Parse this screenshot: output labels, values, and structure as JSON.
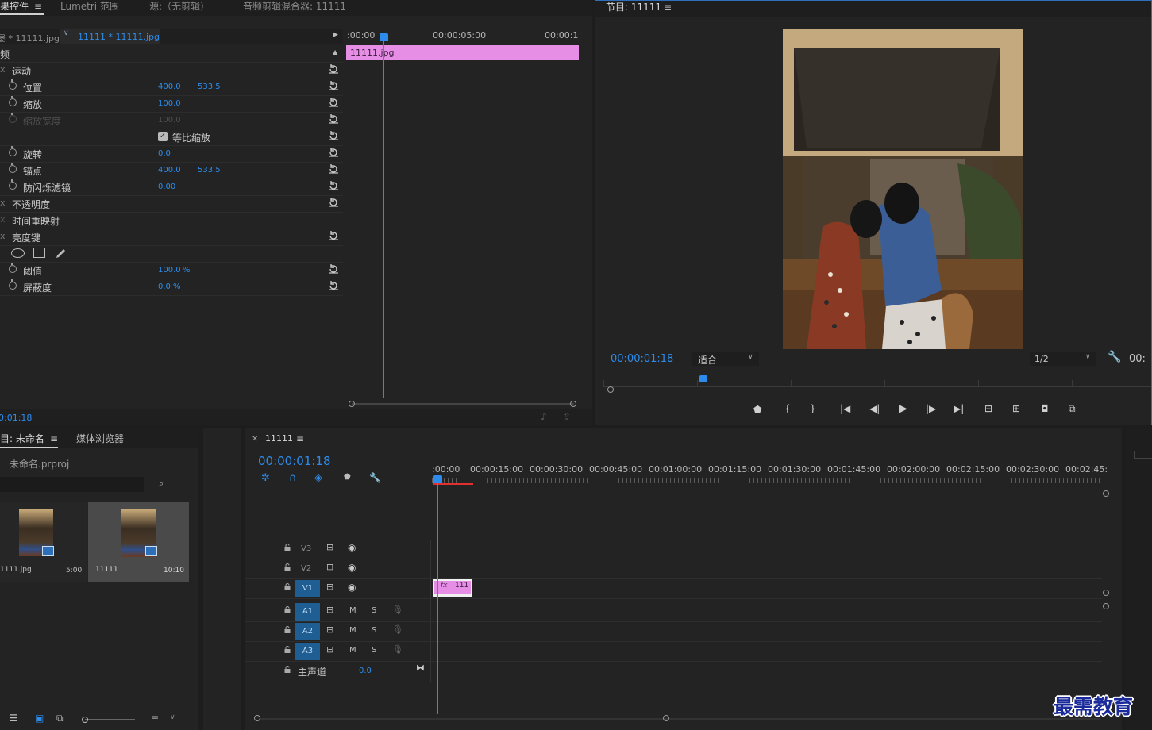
{
  "effect_controls": {
    "tabs": [
      "果控件",
      "Lumetri 范围",
      "源:（无剪辑）",
      "音频剪辑混合器: 11111"
    ],
    "source_label": "屡 * 11111.jpg",
    "clip_dropdown": "11111 * 11111.jpg",
    "section_video": "频",
    "rows": {
      "motion": "运动",
      "position": {
        "label": "位置",
        "x": "400.0",
        "y": "533.5"
      },
      "scale": {
        "label": "缩放",
        "value": "100.0"
      },
      "scale_width": {
        "label": "缩放宽度",
        "value": "100.0"
      },
      "uniform_scale": "等比缩放",
      "rotation": {
        "label": "旋转",
        "value": "0.0"
      },
      "anchor": {
        "label": "锚点",
        "x": "400.0",
        "y": "533.5"
      },
      "anti_flicker": {
        "label": "防闪烁滤镜",
        "value": "0.00"
      },
      "opacity": "不透明度",
      "time_remap": "时间重映射",
      "luma_key": "亮度键",
      "threshold": {
        "label": "阈值",
        "value": "100.0",
        "unit": "%"
      },
      "cutoff": {
        "label": "屏蔽度",
        "value": "0.0",
        "unit": "%"
      }
    },
    "fx_marker": "x",
    "ruler": {
      "t0": ":00:00",
      "t1": "00:00:05:00",
      "t2": "00:00:1"
    },
    "clip_name": "11111.jpg",
    "bottom_time": "0:01:18"
  },
  "program_monitor": {
    "title": "节目: 11111",
    "timecode": "00:00:01:18",
    "fit": "适合",
    "resolution": "1/2",
    "right_time": "00:"
  },
  "project": {
    "tabs": [
      "目: 未命名",
      "媒体浏览器"
    ],
    "project_file": "未命名.prproj",
    "items": [
      {
        "name": "1111.jpg",
        "duration": "5:00"
      },
      {
        "name": "11111",
        "duration": "10:10"
      }
    ]
  },
  "timeline": {
    "tab": "11111",
    "timecode": "00:00:01:18",
    "ruler": [
      ":00:00",
      "00:00:15:00",
      "00:00:30:00",
      "00:00:45:00",
      "00:01:00:00",
      "00:01:15:00",
      "00:01:30:00",
      "00:01:45:00",
      "00:02:00:00",
      "00:02:15:00",
      "00:02:30:00",
      "00:02:45:"
    ],
    "video_tracks": [
      "V3",
      "V2",
      "V1"
    ],
    "audio_tracks": [
      "A1",
      "A2",
      "A3"
    ],
    "mute": "M",
    "solo": "S",
    "master": "主声道",
    "master_value": "0.0",
    "clip": {
      "fx": "fx",
      "name": "111"
    }
  },
  "watermark": "最需教育",
  "colors": {
    "accent": "#2d8ceb",
    "clip": "#e68ee6",
    "badge": "#1f5e93"
  }
}
